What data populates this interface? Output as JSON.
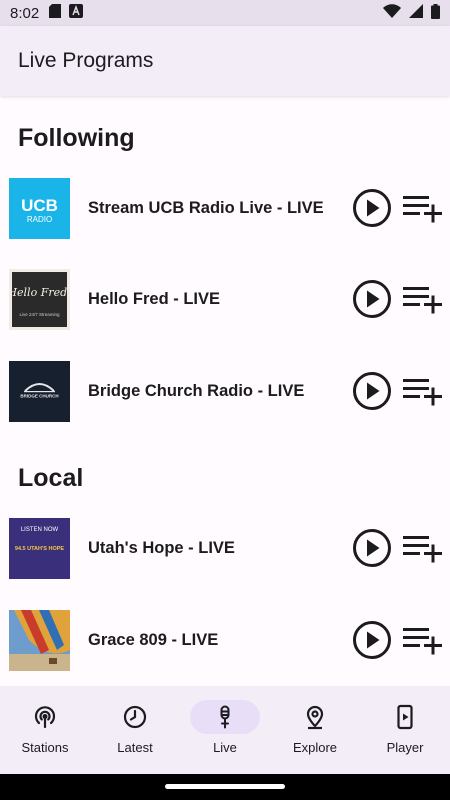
{
  "status_bar": {
    "time": "8:02"
  },
  "app_bar": {
    "title": "Live Programs"
  },
  "sections": {
    "following": {
      "title": "Following",
      "items": [
        {
          "label": "Stream UCB Radio Live - LIVE",
          "thumb": "ucb-radio-logo",
          "thumb_text": "UCB",
          "thumb_sub": "RADIO",
          "color": "#1ab4e8"
        },
        {
          "label": "Hello Fred - LIVE",
          "thumb": "hello-fred-chalkboard",
          "thumb_text": "Hello Fred!",
          "thumb_sub": "Live 24/7 Streaming",
          "color": "#2a2a2a"
        },
        {
          "label": "Bridge Church Radio - LIVE",
          "thumb": "bridge-church-logo",
          "thumb_text": "BRIDGE CHURCH",
          "color": "#17202e"
        }
      ]
    },
    "local": {
      "title": "Local",
      "items": [
        {
          "label": "Utah's Hope - LIVE",
          "thumb": "utahs-hope-logo",
          "thumb_text": "LISTEN NOW",
          "thumb_sub": "94.5 UTAH'S HOPE",
          "color": "#3a2f7a"
        },
        {
          "label": "Grace 809 - LIVE",
          "thumb": "hot-air-balloon-photo",
          "color": "#d9a234"
        }
      ]
    }
  },
  "nav": {
    "items": [
      {
        "label": "Stations",
        "icon": "podcast-icon"
      },
      {
        "label": "Latest",
        "icon": "clock-icon"
      },
      {
        "label": "Live",
        "icon": "microphone-icon",
        "active": true
      },
      {
        "label": "Explore",
        "icon": "location-pin-icon"
      },
      {
        "label": "Player",
        "icon": "phone-play-icon"
      }
    ]
  },
  "colors": {
    "background": "#fffbfe",
    "bar": "#f3edf7",
    "active_indicator": "#e8def8",
    "icon": "#1c1b1f"
  }
}
